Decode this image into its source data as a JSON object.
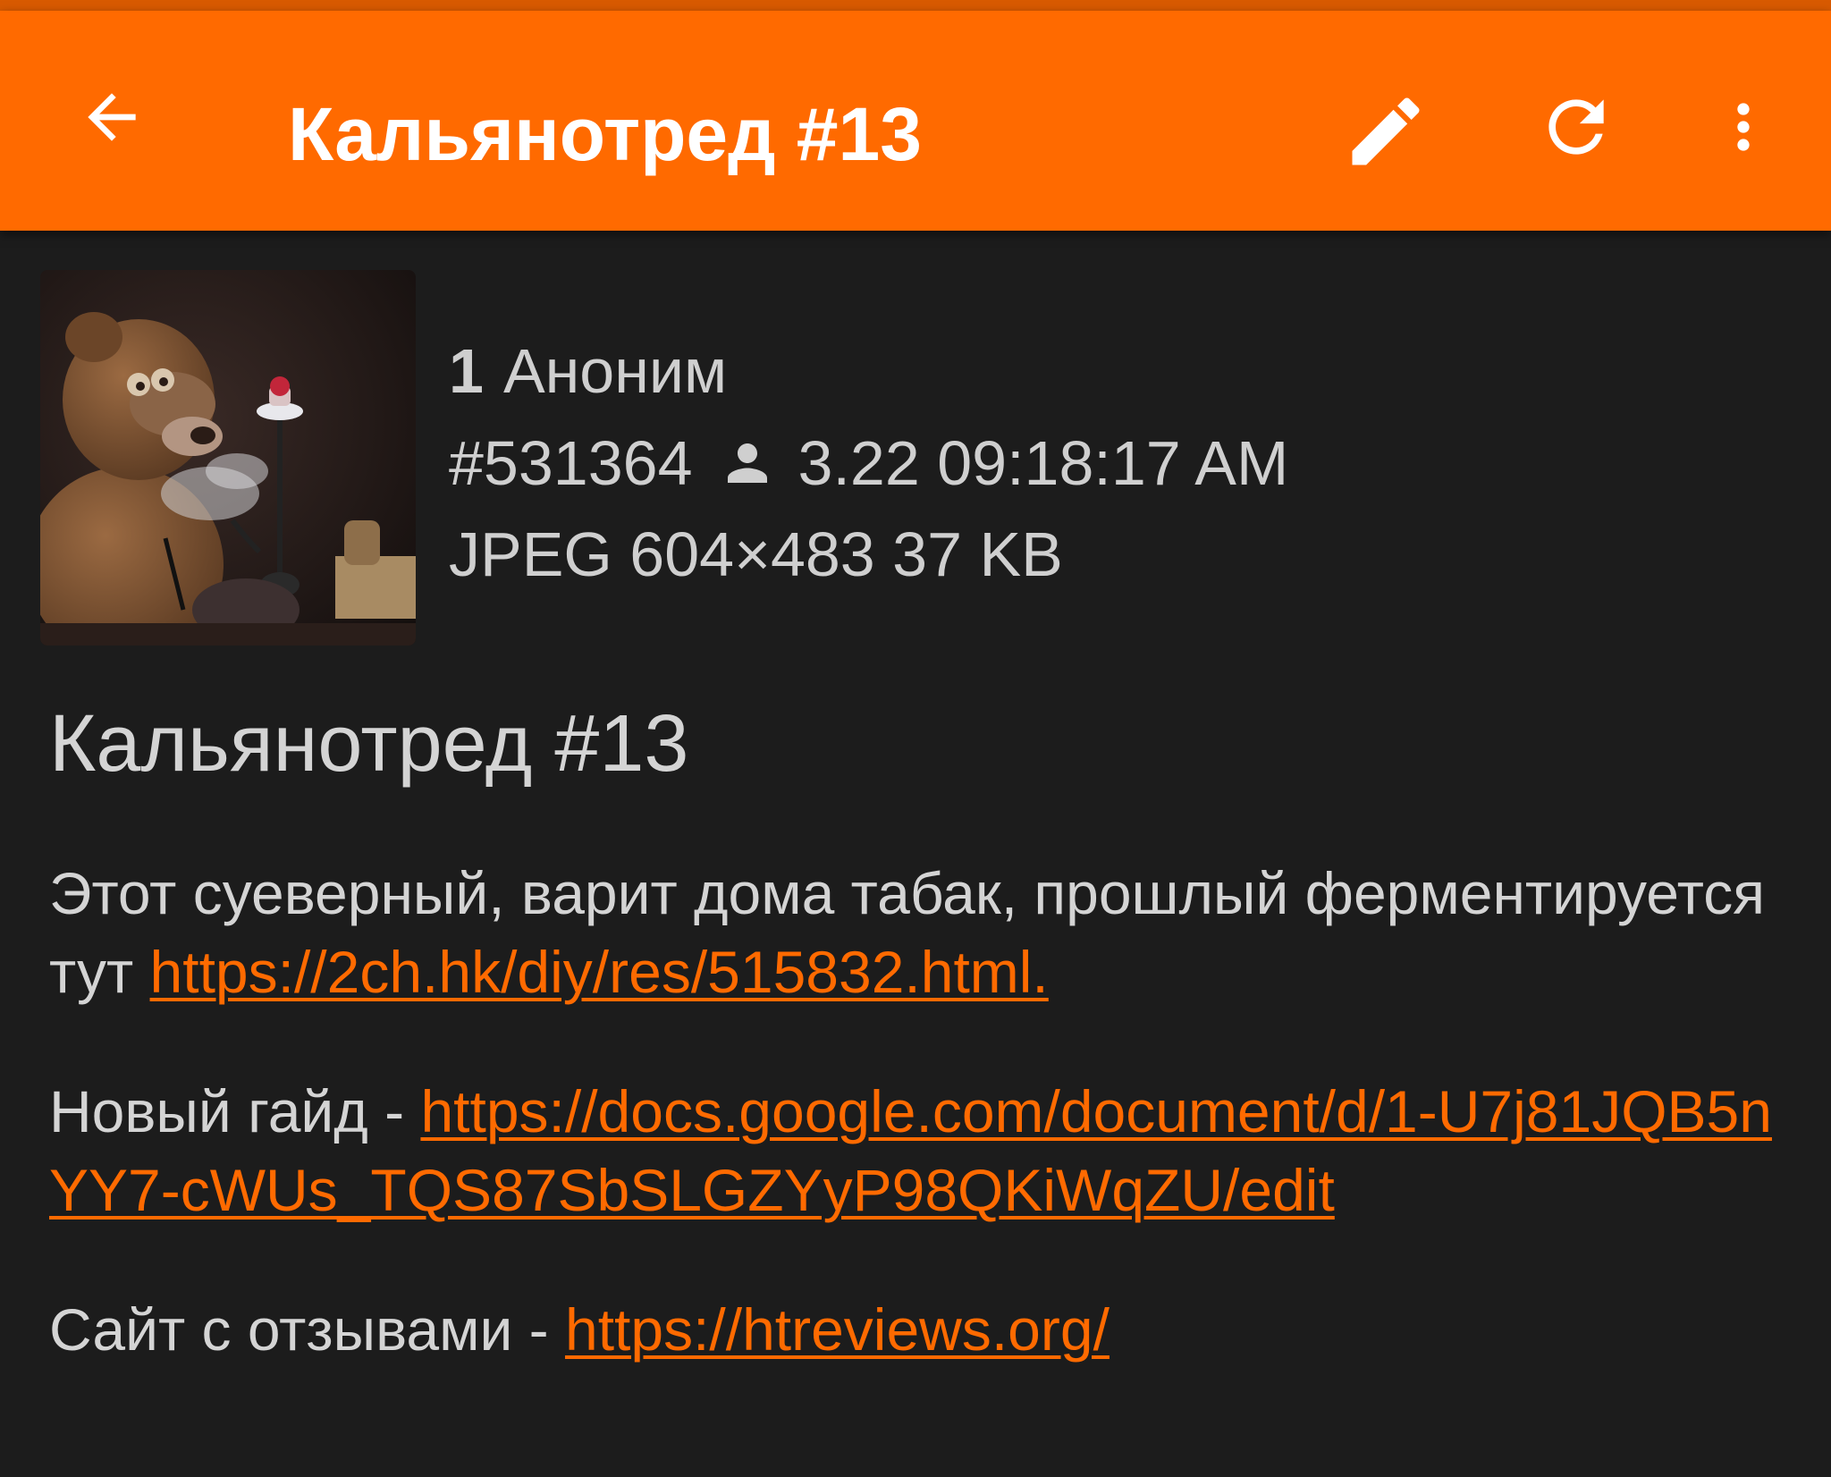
{
  "toolbar": {
    "title": "Кальянотред #13",
    "back_icon": "arrow-left-icon",
    "edit_icon": "pencil-icon",
    "refresh_icon": "refresh-icon",
    "more_icon": "more-vert-icon",
    "color": "#ff6a00"
  },
  "post": {
    "number": "1",
    "author": "Аноним",
    "id": "#531364",
    "author_icon": "person-icon",
    "datetime": "3.22 09:18:17 AM",
    "file_info": "JPEG 604×483 37 KB",
    "subject": "Кальянотред #13",
    "paragraphs": {
      "p1_text": "Этот суеверный, варит дома табак, прошлый ферментируется тут ",
      "p1_link": "https://2ch.hk/diy/res/515832.html.",
      "p2_text": "Новый гайд - ",
      "p2_link": "https://docs.google.com/document/d/1-U7j81JQB5nYY7-cWUs_TQS87SbSLGZYyP98QKiWqZU/edit",
      "p3_text": "Сайт с отзывами - ",
      "p3_link": "https://htreviews.org/"
    }
  },
  "colors": {
    "accent": "#ff6a00",
    "background": "#1c1c1c",
    "text": "#d4d4d4"
  }
}
